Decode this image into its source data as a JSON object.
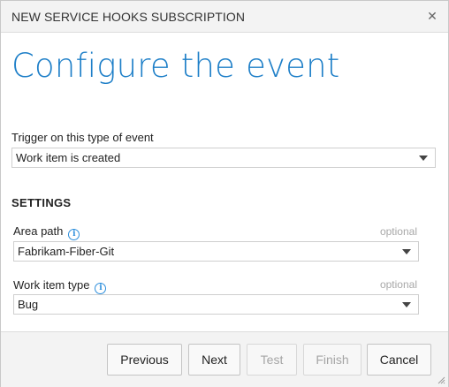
{
  "dialog": {
    "title": "NEW SERVICE HOOKS SUBSCRIPTION",
    "close_icon": "close-icon",
    "heading": "Configure the event"
  },
  "trigger": {
    "label": "Trigger on this type of event",
    "value": "Work item is created"
  },
  "settings": {
    "title": "SETTINGS",
    "area_path": {
      "label": "Area path",
      "optional": "optional",
      "value": "Fabrikam-Fiber-Git",
      "icon": "info-icon"
    },
    "work_item_type": {
      "label": "Work item type",
      "optional": "optional",
      "value": "Bug",
      "icon": "info-icon"
    }
  },
  "footer": {
    "previous": "Previous",
    "next": "Next",
    "test": "Test",
    "finish": "Finish",
    "cancel": "Cancel"
  },
  "colors": {
    "accent": "#1e7fc8",
    "info": "#2e8fdc"
  }
}
